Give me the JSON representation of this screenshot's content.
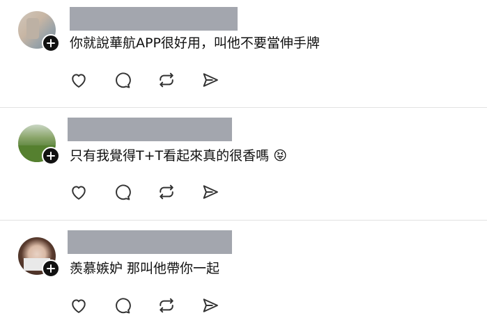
{
  "posts": [
    {
      "text": "你就說華航APP很好用，叫他不要當伸手牌"
    },
    {
      "text": "只有我覺得T+T看起來真的很香嗎",
      "emoji": "😝"
    },
    {
      "text": "羨慕嫉妒 那叫他帶你一起"
    }
  ],
  "actions": [
    "heart-icon",
    "comment-icon",
    "repost-icon",
    "share-icon"
  ],
  "colors": {
    "name_redaction": "#a3a6ae",
    "divider": "#e2e2e2",
    "plus_badge": "#111111"
  }
}
